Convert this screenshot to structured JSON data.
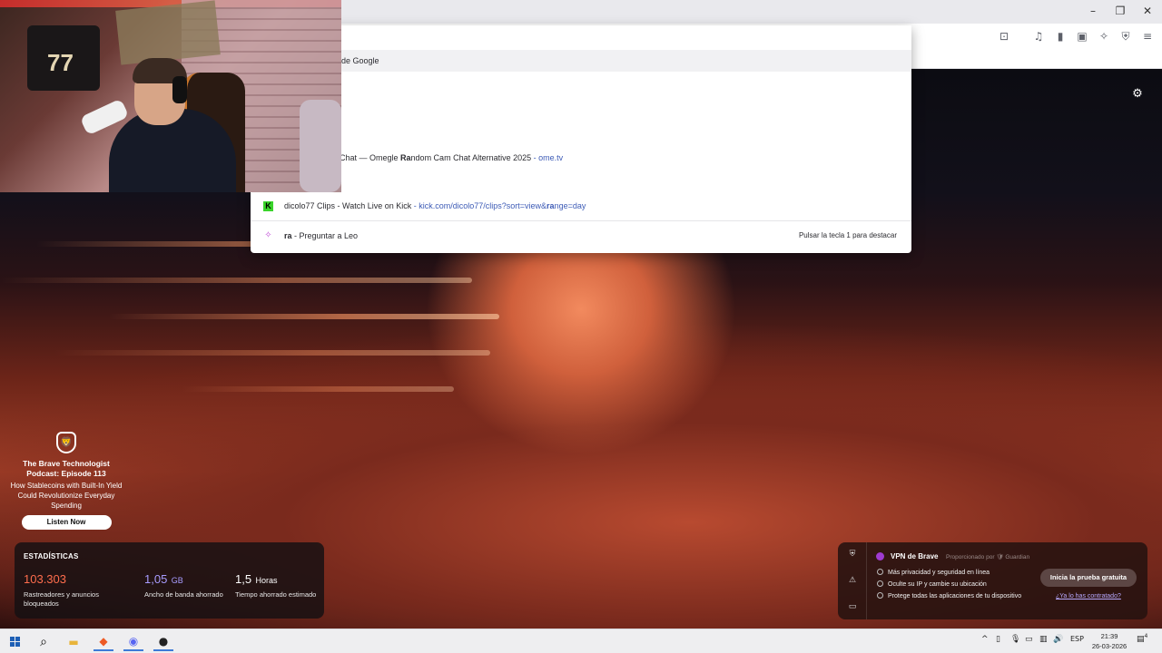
{
  "window": {
    "controls": {
      "minimize": "–",
      "restore": "❐",
      "close": "✕"
    }
  },
  "toolbar_icons": [
    {
      "name": "reader-mode-icon",
      "glyph": "⊡"
    },
    {
      "name": "media-icon",
      "glyph": "♫"
    },
    {
      "name": "sidebar-icon",
      "glyph": "▮"
    },
    {
      "name": "wallet-icon",
      "glyph": "▣"
    },
    {
      "name": "leo-ai-icon",
      "glyph": "✧"
    },
    {
      "name": "brave-shields-icon",
      "glyph": "⛨"
    },
    {
      "name": "menu-icon",
      "glyph": "≡"
    }
  ],
  "omnibox": {
    "rows": [
      {
        "type": "search",
        "text": "de Google"
      },
      {
        "type": "site",
        "title_pre": "Chat — Omegle ",
        "title_match": "Ra",
        "title_post": "ndom Cam Chat Alternative 2025",
        "sep": " - ",
        "url": "ome.tv"
      },
      {
        "type": "kick",
        "icon_letter": "K",
        "title": "dicolo77 Clips - Watch Live on Kick",
        "sep": " - ",
        "url_pre": "kick.com/dicolo77/clips?sort=view&",
        "url_match": "ra",
        "url_post": "nge=day"
      },
      {
        "type": "leo",
        "query": "ra",
        "sep": " - ",
        "action": "Preguntar a Leo",
        "hint": "Pulsar la tecla 1 para destacar"
      }
    ]
  },
  "webcam": {
    "jersey_number": "77"
  },
  "promo": {
    "title": "The Brave Technologist Podcast: Episode 113",
    "subtitle": "How Stablecoins with Built-In Yield Could Revolutionize Everyday Spending",
    "button": "Listen Now",
    "logo_glyph": "🦁"
  },
  "stats": {
    "title": "ESTADÍSTICAS",
    "items": [
      {
        "value": "103.303",
        "unit": "",
        "desc": "Rastreadores y anuncios bloqueados",
        "color": "#ff6d4d"
      },
      {
        "value": "1,05",
        "unit": "GB",
        "desc": "Ancho de banda ahorrado",
        "color": "#a89cff"
      },
      {
        "value": "1,5",
        "unit": "Horas",
        "desc": "Tiempo ahorrado estimado",
        "color": "#ffffff"
      }
    ]
  },
  "vpn": {
    "title": "VPN de Brave",
    "provider": "Proporcionado por 🛡 Guardian",
    "features": [
      "Más privacidad y seguridad en línea",
      "Oculte su IP y cambie su ubicación",
      "Protege todas las aplicaciones de tu dispositivo"
    ],
    "cta": "Inicia la prueba gratuita",
    "link": "¿Ya lo has contratado?",
    "side_icons": [
      "⛨",
      "⚠",
      "▭"
    ]
  },
  "settings_icon": "⚙",
  "taskbar": {
    "apps": [
      {
        "name": "start-button",
        "glyph": ""
      },
      {
        "name": "search-icon",
        "glyph": "⌕"
      },
      {
        "name": "file-explorer-icon",
        "glyph": "▬"
      },
      {
        "name": "brave-browser-icon",
        "glyph": "◆"
      },
      {
        "name": "discord-icon",
        "glyph": "◉"
      },
      {
        "name": "obs-icon",
        "glyph": "●"
      }
    ],
    "tray": {
      "chevron": "^",
      "lang": "ESP"
    },
    "clock": {
      "time": "21:39",
      "date": "26-03-2026"
    },
    "notifications": "4"
  }
}
